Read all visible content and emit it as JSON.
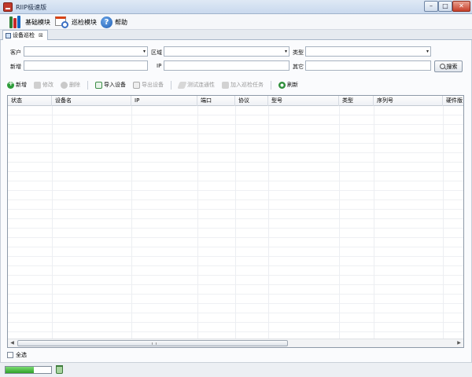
{
  "window": {
    "title": "RIIP极速版",
    "min": "–",
    "max": "□",
    "close": "✕"
  },
  "menu": [
    {
      "label": "基础模块",
      "icon": "books-icon"
    },
    {
      "label": "巡检模块",
      "icon": "calendar-clock-icon"
    },
    {
      "label": "帮助",
      "icon": "help-icon"
    }
  ],
  "tab": {
    "label": "设备巡检",
    "close": "⊠"
  },
  "filters": {
    "customer_label": "客户",
    "region_label": "区域",
    "type_label": "类型",
    "new_label": "新增",
    "ip_label": "IP",
    "other_label": "其它",
    "search_label": "搜索",
    "dropdown_arrow": "▾"
  },
  "toolbar": [
    {
      "label": "新增",
      "icon": "add-icon",
      "enabled": true
    },
    {
      "label": "修改",
      "icon": "edit-icon",
      "enabled": false
    },
    {
      "label": "删除",
      "icon": "delete-icon",
      "enabled": false
    },
    {
      "label": "导入设备",
      "icon": "import-icon",
      "enabled": true
    },
    {
      "label": "导出设备",
      "icon": "export-icon",
      "enabled": false
    },
    {
      "label": "测试连通性",
      "icon": "test-icon",
      "enabled": false
    },
    {
      "label": "加入巡检任务",
      "icon": "task-icon",
      "enabled": false
    },
    {
      "label": "刷新",
      "icon": "refresh-icon",
      "enabled": true
    }
  ],
  "grid": {
    "columns": [
      "状态",
      "设备名",
      "IP",
      "端口",
      "协议",
      "型号",
      "类型",
      "序列号",
      "硬件版"
    ],
    "rows": [],
    "scroll_left": "◀",
    "scroll_right": "▶"
  },
  "footer": {
    "select_all": "全选",
    "progress": 0.62
  },
  "colors": {
    "accent": "#2e9d3a",
    "border": "#8d99a8",
    "title_bg": "#c9d9ee"
  }
}
